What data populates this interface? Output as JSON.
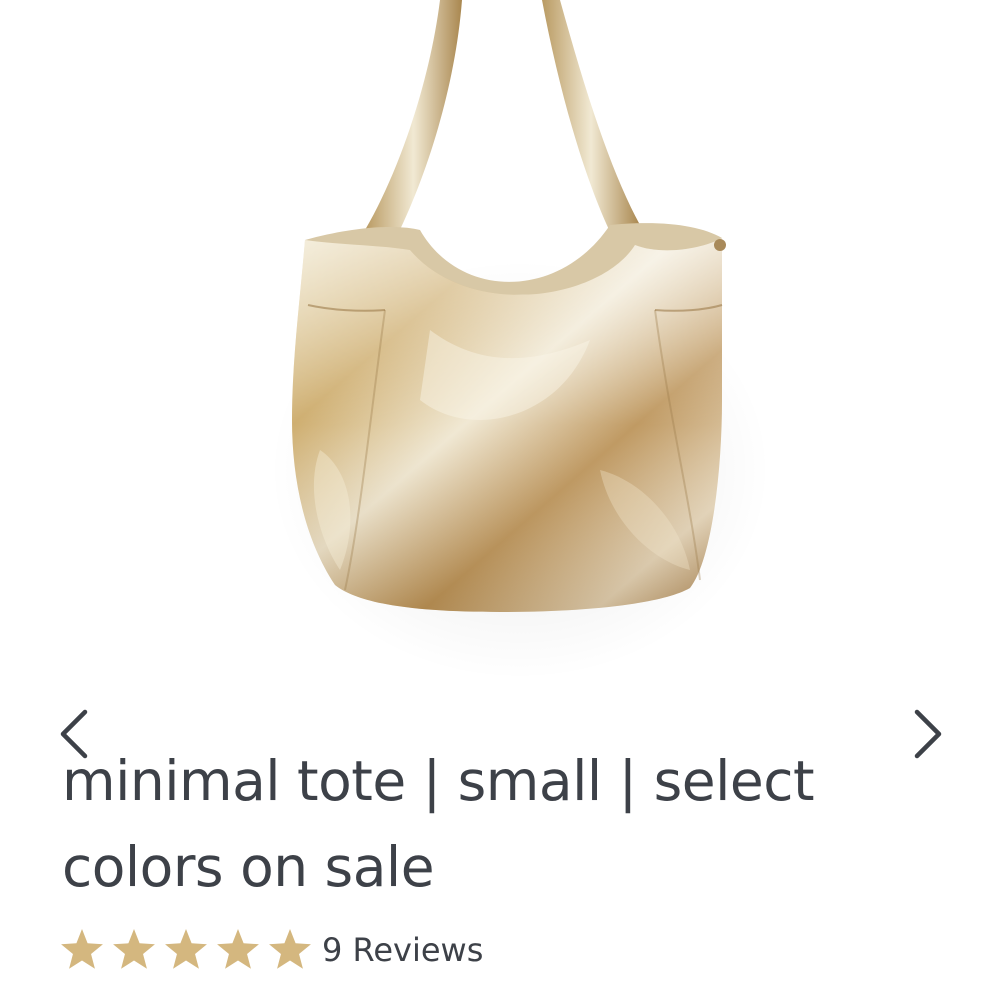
{
  "product": {
    "title": "minimal tote | small | select colors on sale",
    "image_subject": "gold metallic leather tote bag hanging on a white wall"
  },
  "gallery": {
    "prev_icon": "chevron-left-icon",
    "next_icon": "chevron-right-icon"
  },
  "rating": {
    "stars": 5,
    "max_stars": 5,
    "reviews_label": "9 Reviews"
  },
  "colors": {
    "text": "#3d4148",
    "star": "#d4b77f",
    "background": "#ffffff"
  }
}
